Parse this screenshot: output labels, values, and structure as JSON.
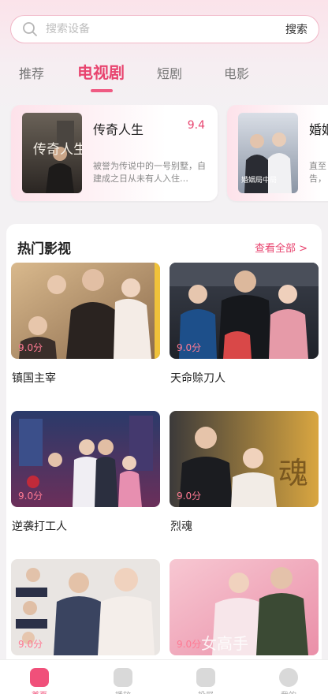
{
  "search": {
    "placeholder": "搜索设备",
    "button_label": "搜索"
  },
  "tabs": [
    {
      "label": "推荐"
    },
    {
      "label": "电视剧",
      "active": true
    },
    {
      "label": "短剧"
    },
    {
      "label": "电影"
    }
  ],
  "featured": [
    {
      "title": "传奇人生",
      "score": "9.4",
      "description": "被誉为传说中的一号别墅，自建成之日从未有人入住…",
      "poster_text": "传奇人生"
    },
    {
      "title": "婚姻",
      "score": "",
      "description": "直至告，",
      "poster_text": "婚姻局中局"
    }
  ],
  "section": {
    "title": "热门影视",
    "see_all": "查看全部 >"
  },
  "videos": [
    {
      "title": "镇国主宰",
      "score": "9.0分"
    },
    {
      "title": "天命赊刀人",
      "score": "9.0分"
    },
    {
      "title": "逆袭打工人",
      "score": "9.0分"
    },
    {
      "title": "烈魂",
      "score": "9.0分"
    },
    {
      "title": "",
      "score": "9.0分"
    },
    {
      "title": "",
      "score": "9.0分"
    }
  ],
  "tabbar": [
    {
      "label": "首页",
      "icon": "home-icon",
      "active": true
    },
    {
      "label": "播放",
      "icon": "play-icon"
    },
    {
      "label": "投屏",
      "icon": "cast-icon"
    },
    {
      "label": "我的",
      "icon": "user-icon"
    }
  ],
  "colors": {
    "accent": "#e8446f",
    "border": "#f1b7c7",
    "score": "#ff7a93"
  }
}
